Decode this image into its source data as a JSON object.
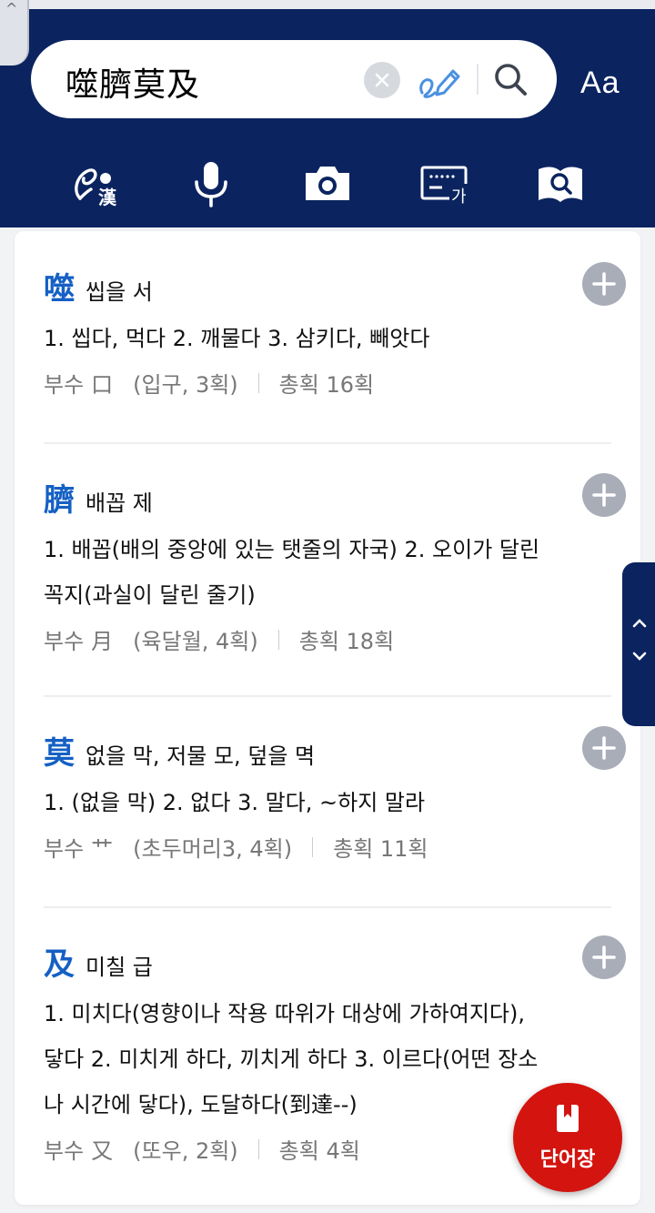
{
  "search": {
    "query": "噬臍莫及",
    "clear_icon": "close-icon",
    "handwriting_icon": "handwriting-pen-icon",
    "search_icon": "search-icon"
  },
  "font_button_label": "Aa",
  "tools": [
    {
      "name": "hanja-handwriting-tool",
      "icon": "hanja-handwriting-icon",
      "label": "漢"
    },
    {
      "name": "voice-search-tool",
      "icon": "microphone-icon"
    },
    {
      "name": "camera-search-tool",
      "icon": "camera-icon"
    },
    {
      "name": "keyboard-tool",
      "icon": "keyboard-icon",
      "label": "가"
    },
    {
      "name": "dictionary-tool",
      "icon": "book-search-icon"
    }
  ],
  "entries": [
    {
      "hanja": "噬",
      "reading": "씹을 서",
      "meaning_lines": [
        "1. 씹다, 먹다 2. 깨물다 3. 삼키다, 빼앗다"
      ],
      "radical_label": "부수",
      "radical": "口",
      "radical_info": "(입구, 3획)",
      "total": "총획 16획"
    },
    {
      "hanja": "臍",
      "reading": "배꼽 제",
      "meaning_lines": [
        "1. 배꼽(배의 중앙에 있는 탯줄의 자국) 2. 오이가 달린",
        "꼭지(과실이 달린 줄기)"
      ],
      "radical_label": "부수",
      "radical": "月",
      "radical_info": "(육달월, 4획)",
      "total": "총획 18획"
    },
    {
      "hanja": "莫",
      "reading": "없을 막, 저물 모, 덮을 멱",
      "meaning_lines": [
        "1. (없을 막) 2. 없다 3. 말다, ~하지 말라"
      ],
      "radical_label": "부수",
      "radical": "艹",
      "radical_info": "(초두머리3, 4획)",
      "total": "총획 11획"
    },
    {
      "hanja": "及",
      "reading": "미칠 급",
      "meaning_lines": [
        "1. 미치다(영향이나 작용 따위가 대상에 가하여지다),",
        "닿다 2. 미치게 하다, 끼치게 하다 3. 이르다(어떤 장소",
        "나 시간에 닿다), 도달하다(到達--)"
      ],
      "radical_label": "부수",
      "radical": "又",
      "radical_info": "(또우, 2획)",
      "total": "총획 4획"
    }
  ],
  "fab": {
    "label": "단어장",
    "icon": "wordbook-icon"
  },
  "colors": {
    "header": "#0b2460",
    "accent_hanja": "#1560c4",
    "fab": "#d3140f"
  }
}
